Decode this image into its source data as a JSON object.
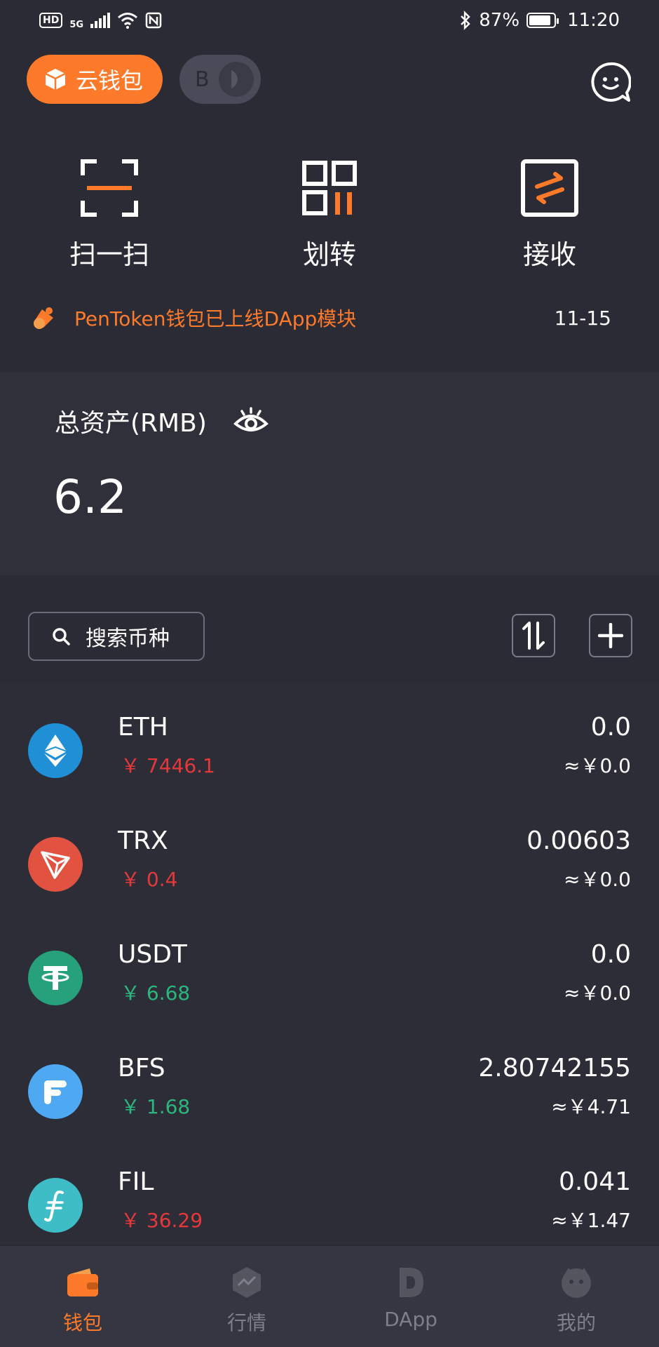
{
  "status_bar": {
    "hd": "HD",
    "network": "5G",
    "battery_pct": "87%",
    "battery_level": 0.87,
    "time": "11:20"
  },
  "header": {
    "cloud_wallet_label": "云钱包",
    "toggle_letter": "B"
  },
  "actions": [
    {
      "label": "扫一扫",
      "icon": "scan-icon"
    },
    {
      "label": "划转",
      "icon": "transfer-qr-icon"
    },
    {
      "label": "接收",
      "icon": "receive-icon"
    }
  ],
  "notice": {
    "text": "PenToken钱包已上线DApp模块",
    "date": "11-15",
    "icon": "megaphone-icon"
  },
  "assets": {
    "title": "总资产(RMB)",
    "value": "6.2"
  },
  "search": {
    "placeholder": "搜索币种"
  },
  "tokens": [
    {
      "symbol": "ETH",
      "price": "￥ 7446.1",
      "amount": "0.0",
      "value": "≈￥0.0",
      "trend": "down",
      "color": "#1f8fd6",
      "icon": "eth-icon"
    },
    {
      "symbol": "TRX",
      "price": "￥ 0.4",
      "amount": "0.00603",
      "value": "≈￥0.0",
      "trend": "down",
      "color": "#e15241",
      "icon": "trx-icon"
    },
    {
      "symbol": "USDT",
      "price": "￥ 6.68",
      "amount": "0.0",
      "value": "≈￥0.0",
      "trend": "up",
      "color": "#26a17b",
      "icon": "usdt-icon"
    },
    {
      "symbol": "BFS",
      "price": "￥ 1.68",
      "amount": "2.80742155",
      "value": "≈￥4.71",
      "trend": "up",
      "color": "#4ea8f2",
      "icon": "bfs-icon"
    },
    {
      "symbol": "FIL",
      "price": "￥ 36.29",
      "amount": "0.041",
      "value": "≈￥1.47",
      "trend": "down",
      "color": "#3fbdc6",
      "icon": "fil-icon"
    }
  ],
  "nav": [
    {
      "label": "钱包",
      "icon": "wallet-icon",
      "active": true
    },
    {
      "label": "行情",
      "icon": "market-icon",
      "active": false
    },
    {
      "label": "DApp",
      "icon": "dapp-icon",
      "active": false
    },
    {
      "label": "我的",
      "icon": "profile-icon",
      "active": false
    }
  ],
  "colors": {
    "accent": "#fd7a2b",
    "price_down": "#e5383b",
    "price_up": "#2cb67d"
  }
}
